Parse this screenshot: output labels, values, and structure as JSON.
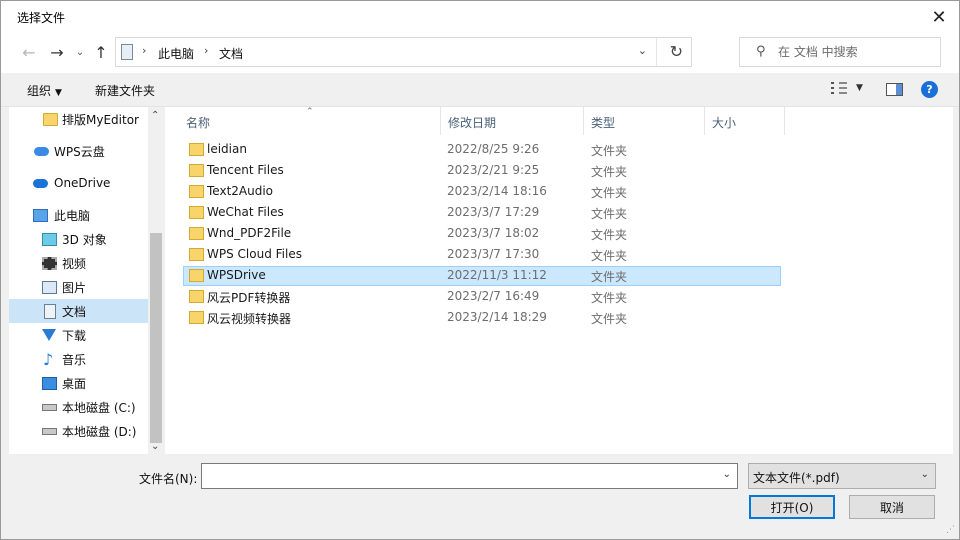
{
  "window": {
    "title": "选择文件"
  },
  "navigation": {
    "breadcrumb": [
      "此电脑",
      "文档"
    ],
    "search_placeholder": "在 文档 中搜索"
  },
  "toolbar": {
    "organize": "组织",
    "new_folder": "新建文件夹",
    "help": "?"
  },
  "nav_pane": {
    "items": [
      {
        "label": "排版MyEditor",
        "icon": "folder-icon"
      },
      {
        "label": "WPS云盘",
        "icon": "cloud-icon"
      },
      {
        "label": "OneDrive",
        "icon": "onedrive-icon"
      },
      {
        "label": "此电脑",
        "icon": "computer-icon"
      },
      {
        "label": "3D 对象",
        "icon": "3d-objects-icon"
      },
      {
        "label": "视频",
        "icon": "video-icon"
      },
      {
        "label": "图片",
        "icon": "pictures-icon"
      },
      {
        "label": "文档",
        "icon": "documents-icon",
        "selected": true
      },
      {
        "label": "下载",
        "icon": "downloads-icon"
      },
      {
        "label": "音乐",
        "icon": "music-icon"
      },
      {
        "label": "桌面",
        "icon": "desktop-icon"
      },
      {
        "label": "本地磁盘 (C:)",
        "icon": "drive-icon"
      },
      {
        "label": "本地磁盘 (D:)",
        "icon": "drive-icon"
      }
    ]
  },
  "file_list": {
    "columns": [
      "名称",
      "修改日期",
      "类型",
      "大小"
    ],
    "rows": [
      {
        "name": "leidian",
        "date": "2022/8/25 9:26",
        "type": "文件夹"
      },
      {
        "name": "Tencent Files",
        "date": "2023/2/21 9:25",
        "type": "文件夹"
      },
      {
        "name": "Text2Audio",
        "date": "2023/2/14 18:16",
        "type": "文件夹"
      },
      {
        "name": "WeChat Files",
        "date": "2023/3/7 17:29",
        "type": "文件夹"
      },
      {
        "name": "Wnd_PDF2File",
        "date": "2023/3/7 18:02",
        "type": "文件夹"
      },
      {
        "name": "WPS Cloud Files",
        "date": "2023/3/7 17:30",
        "type": "文件夹"
      },
      {
        "name": "WPSDrive",
        "date": "2022/11/3 11:12",
        "type": "文件夹",
        "selected": true
      },
      {
        "name": "风云PDF转换器",
        "date": "2023/2/7 16:49",
        "type": "文件夹"
      },
      {
        "name": "风云视频转换器",
        "date": "2023/2/14 18:29",
        "type": "文件夹"
      }
    ]
  },
  "bottom": {
    "filename_label": "文件名(N):",
    "filename_value": "",
    "filter": "文本文件(*.pdf)",
    "open_button": "打开(O)",
    "cancel_button": "取消"
  },
  "colors": {
    "selection": "#cce8ff",
    "accent": "#0078d7",
    "folder": "#f7d56b"
  }
}
